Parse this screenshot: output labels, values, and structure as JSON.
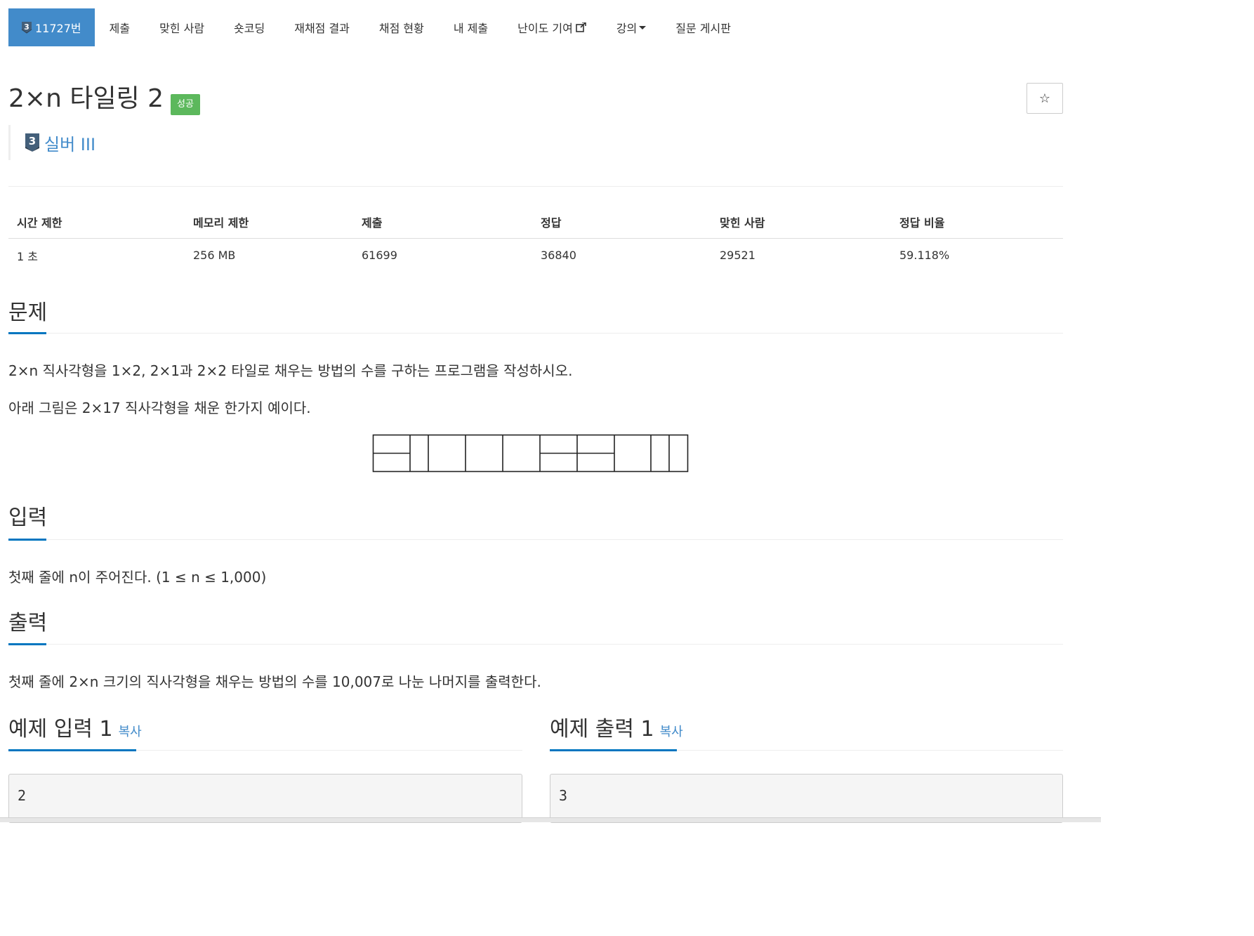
{
  "nav": {
    "problem_number": "11727번",
    "items": [
      {
        "label": "제출"
      },
      {
        "label": "맞힌 사람"
      },
      {
        "label": "숏코딩"
      },
      {
        "label": "재채점 결과"
      },
      {
        "label": "채점 현황"
      },
      {
        "label": "내 제출"
      },
      {
        "label": "난이도 기여"
      },
      {
        "label": "강의"
      },
      {
        "label": "질문 게시판"
      }
    ]
  },
  "problem": {
    "title": "2×n 타일링 2",
    "badge": "성공",
    "tier_number": "3",
    "tier_name": "실버 III",
    "star_label": "☆"
  },
  "stats": {
    "headers": [
      "시간 제한",
      "메모리 제한",
      "제출",
      "정답",
      "맞힌 사람",
      "정답 비율"
    ],
    "values": [
      "1 초",
      "256 MB",
      "61699",
      "36840",
      "29521",
      "59.118%"
    ]
  },
  "sections": {
    "description": {
      "title": "문제",
      "lines": [
        "2×n 직사각형을 1×2, 2×1과 2×2 타일로 채우는 방법의 수를 구하는 프로그램을 작성하시오.",
        "아래 그림은 2×17 직사각형을 채운 한가지 예이다."
      ]
    },
    "input": {
      "title": "입력",
      "text": "첫째 줄에 n이 주어진다. (1 ≤ n ≤ 1,000)"
    },
    "output": {
      "title": "출력",
      "text": "첫째 줄에 2×n 크기의 직사각형을 채우는 방법의 수를 10,007로 나눈 나머지를 출력한다."
    }
  },
  "samples": [
    {
      "title": "예제 입력 1",
      "copy": "복사",
      "value": "2"
    },
    {
      "title": "예제 출력 1",
      "copy": "복사",
      "value": "3"
    }
  ],
  "colors": {
    "primary": "#428bca",
    "success": "#5cb85c",
    "underline": "#0076c0"
  }
}
